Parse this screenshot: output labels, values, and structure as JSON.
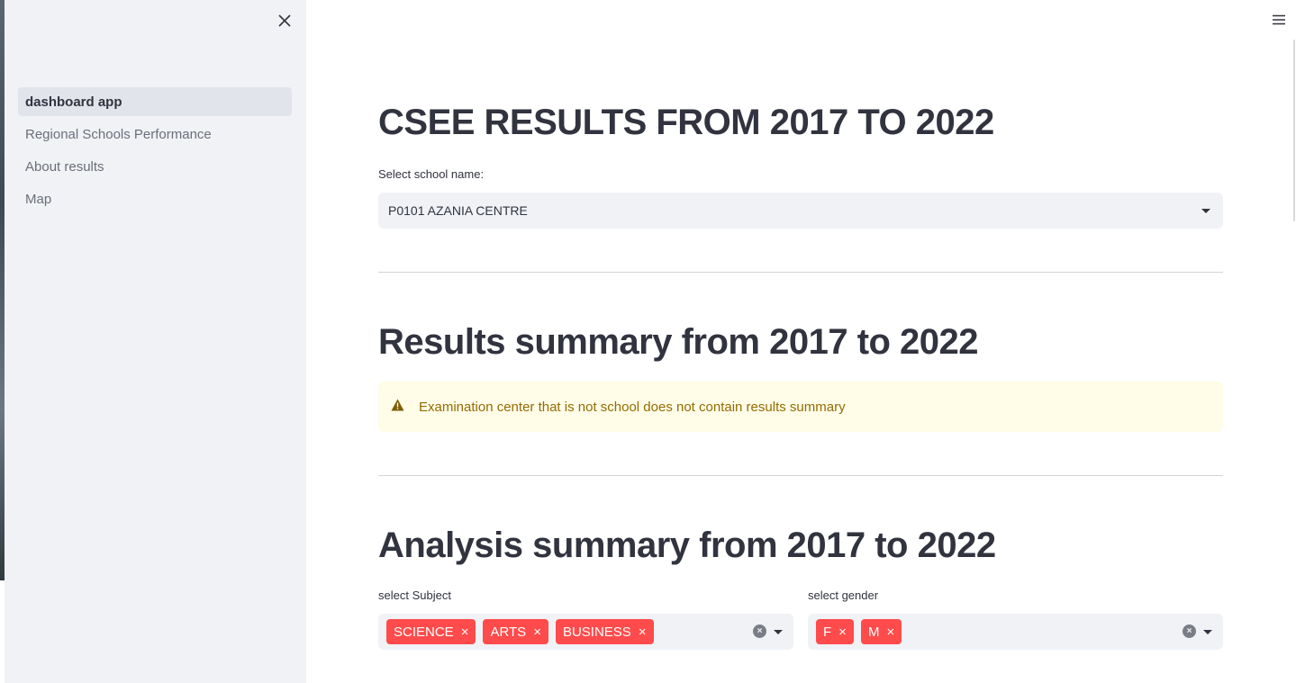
{
  "sidebar": {
    "close_icon": "close-icon",
    "items": [
      {
        "label": "dashboard app",
        "active": true
      },
      {
        "label": "Regional Schools Performance",
        "active": false
      },
      {
        "label": "About results",
        "active": false
      },
      {
        "label": "Map",
        "active": false
      }
    ]
  },
  "header": {
    "menu_icon": "hamburger-menu-icon"
  },
  "main": {
    "title": "CSEE RESULTS FROM 2017 TO 2022",
    "school_select": {
      "label": "Select school name:",
      "value": "P0101 AZANIA CENTRE"
    },
    "results_heading": "Results summary from 2017 to 2022",
    "warning": {
      "icon": "warning-triangle-icon",
      "text": "Examination center that is not school does not contain results summary"
    },
    "analysis_heading": "Analysis summary from 2017 to 2022",
    "subject_select": {
      "label": "select Subject",
      "chips": [
        "SCIENCE",
        "ARTS",
        "BUSINESS"
      ]
    },
    "gender_select": {
      "label": "select gender",
      "chips": [
        "F",
        "M"
      ]
    },
    "chip_remove_glyph": "×"
  },
  "colors": {
    "sidebar_bg": "#f0f2f6",
    "chip_bg": "#ff4b4b",
    "warning_bg": "#fffce7",
    "warning_text": "#926c05",
    "text": "#31333f"
  }
}
